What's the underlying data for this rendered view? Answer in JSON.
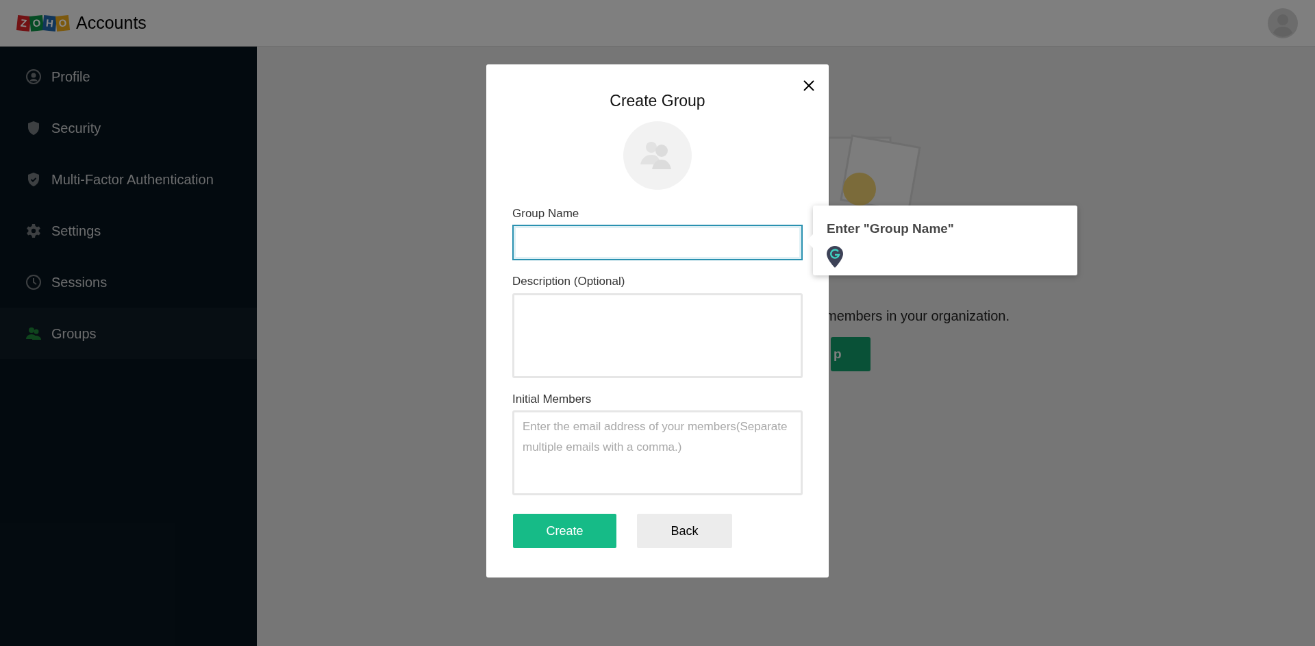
{
  "header": {
    "logo_tiles": [
      {
        "letter": "Z",
        "color": "#721214"
      },
      {
        "letter": "O",
        "color": "#054c24"
      },
      {
        "letter": "H",
        "color": "#11365a"
      },
      {
        "letter": "O",
        "color": "#7c590e"
      }
    ],
    "product": "Accounts"
  },
  "sidebar": {
    "items": [
      {
        "label": "Profile",
        "kind": "profile",
        "selected": false
      },
      {
        "label": "Security",
        "kind": "shield",
        "selected": false
      },
      {
        "label": "Multi-Factor Authentication",
        "kind": "shield-check",
        "selected": false
      },
      {
        "label": "Settings",
        "kind": "gear",
        "selected": false
      },
      {
        "label": "Sessions",
        "kind": "clock",
        "selected": false
      },
      {
        "label": "Groups",
        "kind": "groups",
        "selected": true
      }
    ]
  },
  "background": {
    "text": "members in your organization.",
    "button": "p"
  },
  "dialog": {
    "title": "Create Group",
    "fields": [
      {
        "label": "Group Name",
        "kind": "input",
        "focused": true
      },
      {
        "label": "Description (Optional)",
        "kind": "textarea",
        "focused": false
      },
      {
        "label": "Initial Members",
        "kind": "textarea",
        "focused": false,
        "placeholder": "Enter the email address of your members(Separate multiple emails with a comma.)"
      }
    ],
    "buttons": [
      {
        "label": "Create",
        "kind": "primary"
      },
      {
        "label": "Back",
        "kind": "secondary"
      }
    ]
  },
  "tooltip": {
    "title": "Enter \"Group Name\""
  }
}
